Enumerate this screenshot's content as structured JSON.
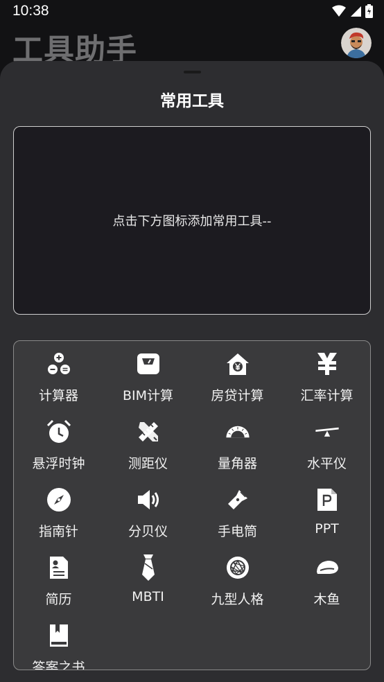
{
  "status": {
    "time": "10:38",
    "icons": [
      "wifi-icon",
      "signal-icon",
      "battery-icon"
    ]
  },
  "header": {
    "title": "工具助手"
  },
  "sheet": {
    "title": "常用工具",
    "empty_hint": "点击下方图标添加常用工具--"
  },
  "tools": [
    {
      "label": "计算器",
      "icon": "calculator-icon"
    },
    {
      "label": "BIM计算",
      "icon": "scale-icon"
    },
    {
      "label": "房贷计算",
      "icon": "house-yen-icon"
    },
    {
      "label": "汇率计算",
      "icon": "exchange-icon"
    },
    {
      "label": "悬浮时钟",
      "icon": "alarm-clock-icon"
    },
    {
      "label": "测距仪",
      "icon": "ruler-pencil-icon"
    },
    {
      "label": "量角器",
      "icon": "protractor-icon"
    },
    {
      "label": "水平仪",
      "icon": "level-icon"
    },
    {
      "label": "指南针",
      "icon": "compass-icon"
    },
    {
      "label": "分贝仪",
      "icon": "speaker-icon"
    },
    {
      "label": "手电筒",
      "icon": "flashlight-icon"
    },
    {
      "label": "PPT",
      "icon": "ppt-icon"
    },
    {
      "label": "简历",
      "icon": "resume-icon"
    },
    {
      "label": "MBTI",
      "icon": "tie-icon"
    },
    {
      "label": "九型人格",
      "icon": "enneagram-icon"
    },
    {
      "label": "木鱼",
      "icon": "wooden-fish-icon"
    },
    {
      "label": "答案之书",
      "icon": "book-icon"
    }
  ]
}
